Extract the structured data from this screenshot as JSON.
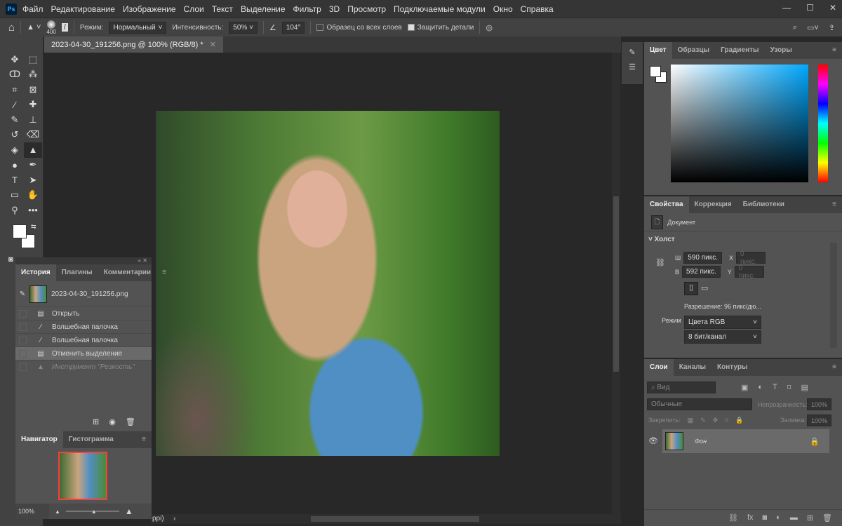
{
  "app": {
    "logo": "Ps"
  },
  "menu": [
    "Файл",
    "Редактирование",
    "Изображение",
    "Слои",
    "Текст",
    "Выделение",
    "Фильтр",
    "3D",
    "Просмотр",
    "Подключаемые модули",
    "Окно",
    "Справка"
  ],
  "window_controls": {
    "minimize": "—",
    "maximize": "☐",
    "close": "✕"
  },
  "options": {
    "brush_size": "400",
    "mode_label": "Режим:",
    "mode_value": "Нормальный",
    "intensity_label": "Интенсивность:",
    "intensity_value": "50%",
    "angle_value": "104°",
    "sample_all_label": "Образец со всех слоев",
    "sample_all_checked": false,
    "protect_label": "Защитить детали",
    "protect_checked": true
  },
  "document": {
    "tab_title": "2023-04-30_191256.png @ 100% (RGB/8) *",
    "status_fragment": "ppi)"
  },
  "color_panel": {
    "tabs": [
      "Цвет",
      "Образцы",
      "Градиенты",
      "Узоры"
    ],
    "hue_color": "#00a8ff"
  },
  "properties": {
    "tabs": [
      "Свойства",
      "Коррекция",
      "Библиотеки"
    ],
    "type": "Документ",
    "section": "Холст",
    "w_label": "Ш",
    "w_value": "590 пикс.",
    "h_label": "В",
    "h_value": "592 пикс.",
    "x_label": "X",
    "x_placeholder": "0 пикс.",
    "y_label": "Y",
    "y_placeholder": "0 пикс.",
    "resolution": "Разрешение: 96 пикс/дю...",
    "mode_label": "Режим",
    "mode_value": "Цвета RGB",
    "depth_value": "8 бит/канал"
  },
  "layers": {
    "tabs": [
      "Слои",
      "Каналы",
      "Контуры"
    ],
    "filter_placeholder": "Вид",
    "blend": "Обычные",
    "opacity_label": "Непрозрачность:",
    "opacity_value": "100%",
    "lock_label": "Закрепить:",
    "fill_label": "Заливка:",
    "fill_value": "100%",
    "items": [
      {
        "name": "Фон",
        "visible": true,
        "locked": true
      }
    ]
  },
  "history": {
    "tabs": [
      "История",
      "Плагины",
      "Комментарии"
    ],
    "snapshot": "2023-04-30_191256.png",
    "items": [
      {
        "label": "Открыть",
        "icon": "document-icon"
      },
      {
        "label": "Волшебная палочка",
        "icon": "magic-wand-icon"
      },
      {
        "label": "Волшебная палочка",
        "icon": "magic-wand-icon"
      },
      {
        "label": "Отменить выделение",
        "icon": "document-icon",
        "selected": true
      },
      {
        "label": "Инструмент \"Резкость\"",
        "icon": "sharpen-icon",
        "undone": true
      }
    ]
  },
  "navigator": {
    "tabs": [
      "Навигатор",
      "Гистограмма"
    ],
    "zoom": "100%",
    "frame_color": "#ff3b3b"
  }
}
